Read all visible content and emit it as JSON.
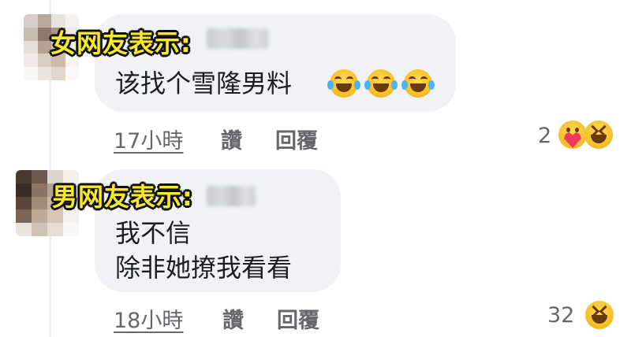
{
  "comments": [
    {
      "label": "女网友表示:",
      "lines": [
        "该找个雪隆男料"
      ],
      "time": "17小時",
      "like": "讚",
      "reply": "回覆",
      "reaction_count": "2",
      "reactions": [
        "care-icon",
        "laughing-squint-icon"
      ],
      "inline_emojis": [
        "tears-of-joy-icon",
        "tears-of-joy-icon",
        "tears-of-joy-icon"
      ]
    },
    {
      "label": "男网友表示:",
      "lines": [
        "我不信",
        "除非她撩我看看"
      ],
      "time": "18小時",
      "like": "讚",
      "reply": "回覆",
      "reaction_count": "32",
      "reactions": [
        "laughing-squint-icon"
      ]
    }
  ],
  "colors": {
    "bubble": "#f0f2f5",
    "meta_text": "#65676b",
    "label_fill": "#f6e82c",
    "label_stroke": "#111111"
  }
}
